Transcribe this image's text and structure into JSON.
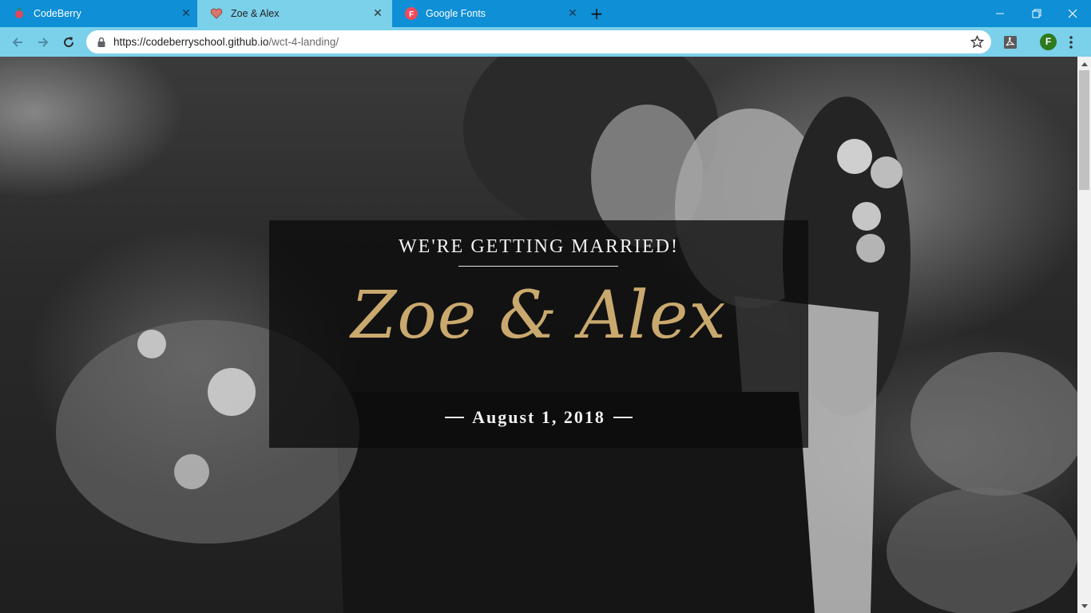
{
  "browser": {
    "tabs": [
      {
        "title": "CodeBerry",
        "icon": "codeberry-icon",
        "active": false
      },
      {
        "title": "Zoe & Alex",
        "icon": "heart-icon",
        "active": true
      },
      {
        "title": "Google Fonts",
        "icon": "google-fonts-icon",
        "active": false
      }
    ],
    "close_glyph": "✕",
    "new_tab_glyph": "+",
    "url_host": "https://codeberryschool.github.io",
    "url_path": "/wct-4-landing/",
    "profile_initial": "F",
    "accent": "#0e8fd6",
    "toolbar_color": "#7bd0ea"
  },
  "hero": {
    "subhead": "WE'RE GETTING MARRIED!",
    "names": "Zoe & Alex",
    "date": "August 1, 2018",
    "names_color": "#c9a96e"
  }
}
